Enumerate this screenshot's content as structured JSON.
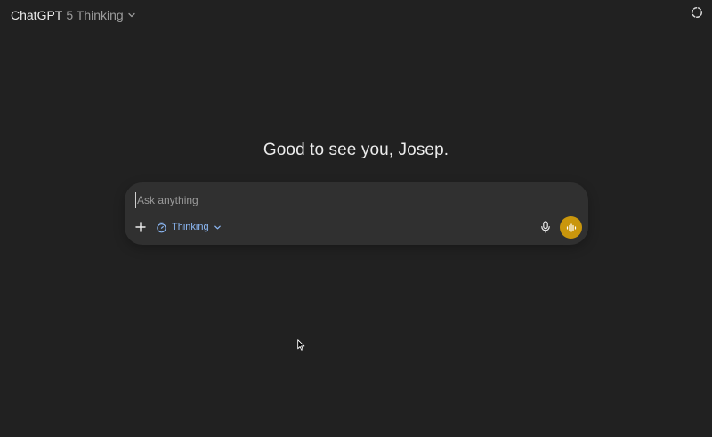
{
  "header": {
    "model_name": "ChatGPT",
    "model_variant": "5 Thinking"
  },
  "greeting": "Good to see you, Josep.",
  "composer": {
    "placeholder": "Ask anything",
    "value": "",
    "mode_label": "Thinking"
  },
  "icons": {
    "model_menu": "chevron-down-icon",
    "temporary_chat": "dashed-circle-icon",
    "attach": "plus-icon",
    "mode": "timer-icon",
    "mode_menu": "chevron-down-icon",
    "dictate": "microphone-icon",
    "voice": "waveform-icon"
  },
  "colors": {
    "background": "#212121",
    "composer": "#303030",
    "accent_mode": "#8cb8f5",
    "voice_button": "#c9960c"
  }
}
